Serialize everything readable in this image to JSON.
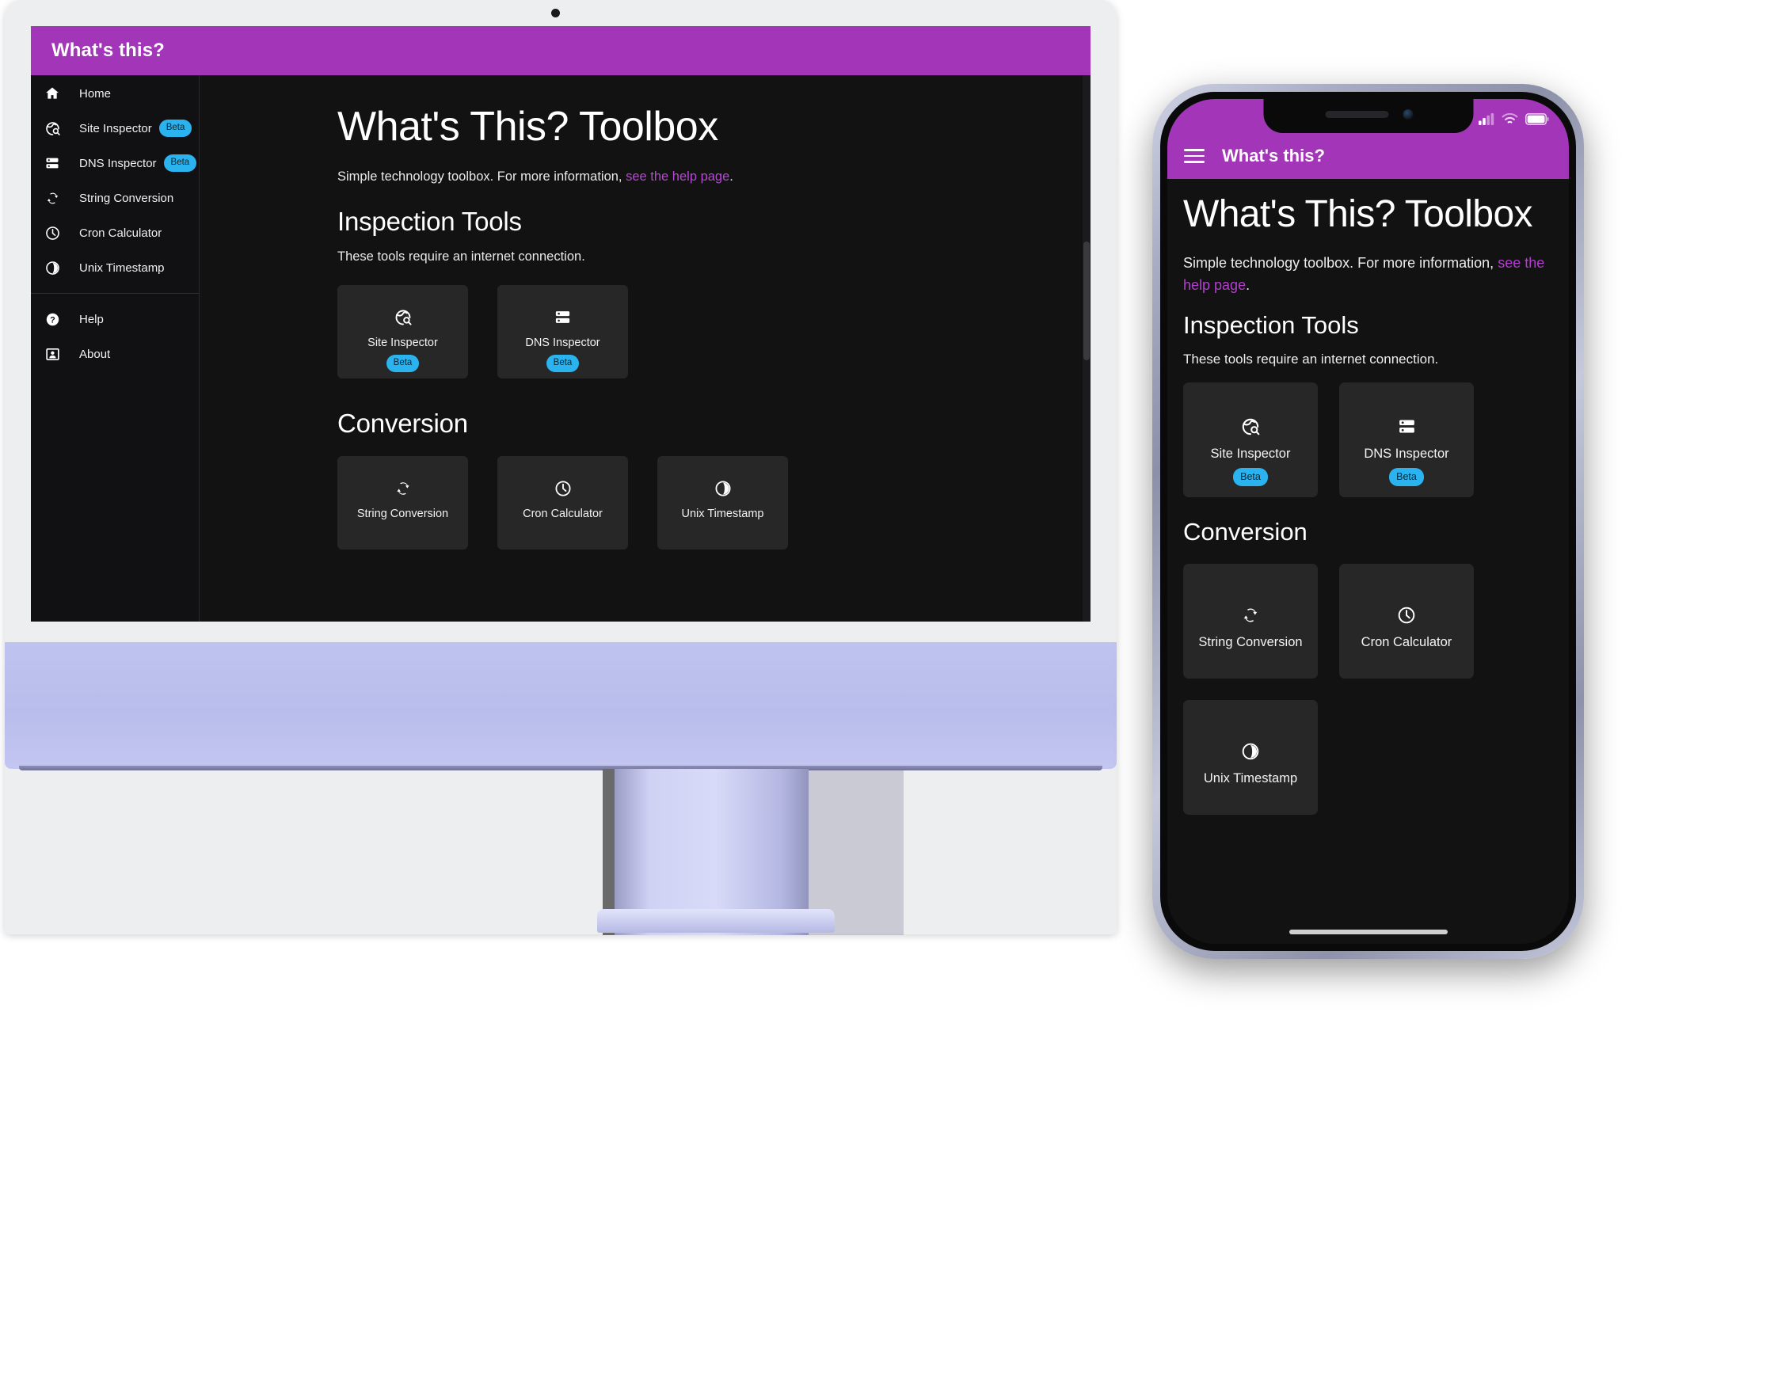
{
  "brand": {
    "accent_purple": "#a336b8",
    "beta_blue": "#2bb3f0",
    "link_purple": "#b44ad0",
    "surface_dark": "#121212",
    "card_dark": "#272727"
  },
  "app": {
    "title": "What's this?"
  },
  "sidebar": {
    "primary_items": [
      {
        "label": "Home",
        "icon": "home-icon",
        "badge": null
      },
      {
        "label": "Site Inspector",
        "icon": "site-inspector-icon",
        "badge": "Beta"
      },
      {
        "label": "DNS Inspector",
        "icon": "dns-inspector-icon",
        "badge": "Beta"
      },
      {
        "label": "String Conversion",
        "icon": "string-conversion-icon",
        "badge": null
      },
      {
        "label": "Cron Calculator",
        "icon": "clock-icon",
        "badge": null
      },
      {
        "label": "Unix Timestamp",
        "icon": "unix-timestamp-icon",
        "badge": null
      }
    ],
    "secondary_items": [
      {
        "label": "Help",
        "icon": "help-circle-icon",
        "badge": null
      },
      {
        "label": "About",
        "icon": "about-person-icon",
        "badge": null
      }
    ]
  },
  "main": {
    "heading": "What's This? Toolbox",
    "lead_prefix": "Simple technology toolbox. For more information, ",
    "lead_link": "see the help page",
    "lead_suffix": ".",
    "sections": [
      {
        "heading": "Inspection Tools",
        "note": "These tools require an internet connection.",
        "cards": [
          {
            "label": "Site Inspector",
            "icon": "site-inspector-icon",
            "badge": "Beta"
          },
          {
            "label": "DNS Inspector",
            "icon": "dns-inspector-icon",
            "badge": "Beta"
          }
        ]
      },
      {
        "heading": "Conversion",
        "note": "",
        "cards": [
          {
            "label": "String Conversion",
            "icon": "string-conversion-icon",
            "badge": null
          },
          {
            "label": "Cron Calculator",
            "icon": "clock-icon",
            "badge": null
          },
          {
            "label": "Unix Timestamp",
            "icon": "unix-timestamp-icon",
            "badge": null
          }
        ]
      }
    ]
  },
  "phone": {
    "statusbar": {
      "signal_icon": "cellular-signal-icon",
      "wifi_icon": "wifi-icon",
      "battery_icon": "battery-icon"
    },
    "appbar": {
      "menu_icon": "hamburger-menu-icon",
      "title": "What's this?"
    },
    "heading": "What's This? Toolbox",
    "lead_prefix": "Simple technology toolbox. For more information, ",
    "lead_link": "see the help page",
    "lead_suffix": ".",
    "sections": [
      {
        "heading": "Inspection Tools",
        "note": "These tools require an internet connection.",
        "cards": [
          {
            "label": "Site Inspector",
            "icon": "site-inspector-icon",
            "badge": "Beta"
          },
          {
            "label": "DNS Inspector",
            "icon": "dns-inspector-icon",
            "badge": "Beta"
          }
        ]
      },
      {
        "heading": "Conversion",
        "note": "",
        "cards": [
          {
            "label": "String Conversion",
            "icon": "string-conversion-icon",
            "badge": null
          },
          {
            "label": "Cron Calculator",
            "icon": "clock-icon",
            "badge": null
          },
          {
            "label": "Unix Timestamp",
            "icon": "unix-timestamp-icon",
            "badge": null
          }
        ]
      }
    ]
  }
}
